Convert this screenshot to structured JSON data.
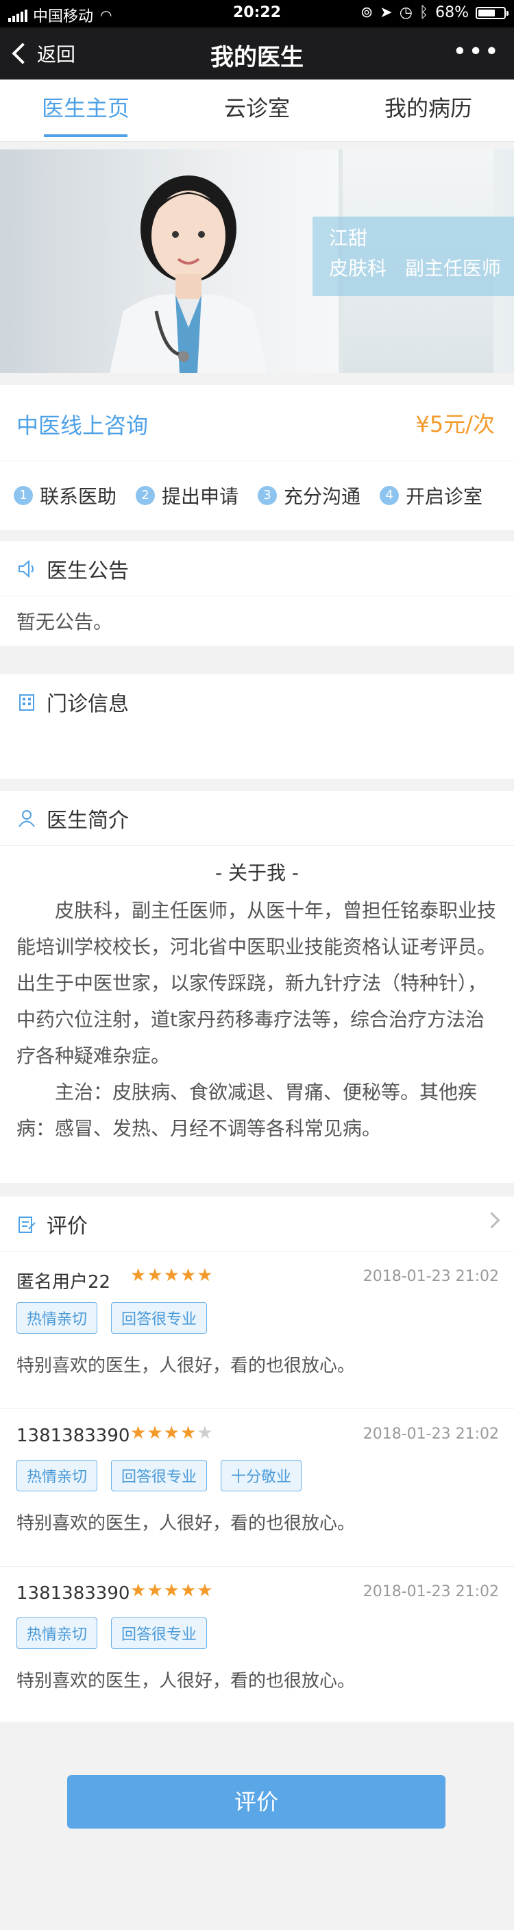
{
  "status_bar": {
    "carrier": "中国移动",
    "time": "20:22",
    "battery": "68%",
    "battery_level": 0.68
  },
  "nav": {
    "back_label": "返回",
    "title": "我的医生"
  },
  "tabs": [
    {
      "label": "医生主页",
      "active": true
    },
    {
      "label": "云诊室",
      "active": false
    },
    {
      "label": "我的病历",
      "active": false
    }
  ],
  "doctor": {
    "name": "江甜",
    "department": "皮肤科",
    "title": "副主任医师"
  },
  "consult": {
    "label": "中医线上咨询",
    "price": "¥5元/次"
  },
  "steps": [
    {
      "num": "1",
      "label": "联系医助"
    },
    {
      "num": "2",
      "label": "提出申请"
    },
    {
      "num": "3",
      "label": "充分沟通"
    },
    {
      "num": "4",
      "label": "开启诊室"
    }
  ],
  "notice": {
    "title": "医生公告",
    "body": "暂无公告。"
  },
  "clinic": {
    "title": "门诊信息"
  },
  "intro": {
    "title": "医生简介",
    "about_heading": "- 关于我 -",
    "paragraph1": "皮肤科，副主任医师，从医十年，曾担任铭泰职业技能培训学校校长，河北省中医职业技能资格认证考评员。出生于中医世家，以家传踩跷，新九针疗法（特种针），中药穴位注射，道t家丹药移毒疗法等，综合治疗方法治疗各种疑难杂症。",
    "paragraph2": "主治：皮肤病、食欲减退、胃痛、便秘等。其他疾病：感冒、发热、月经不调等各科常见病。"
  },
  "reviews": {
    "title": "评价",
    "items": [
      {
        "user": "匿名用户22",
        "stars": 5,
        "date": "2018-01-23  21:02",
        "tags": [
          "热情亲切",
          "回答很专业"
        ],
        "text": "特别喜欢的医生，人很好，看的也很放心。"
      },
      {
        "user": "1381383390",
        "stars": 4,
        "date": "2018-01-23  21:02",
        "tags": [
          "热情亲切",
          "回答很专业",
          "十分敬业"
        ],
        "text": "特别喜欢的医生，人很好，看的也很放心。"
      },
      {
        "user": "1381383390",
        "stars": 5,
        "date": "2018-01-23  21:02",
        "tags": [
          "热情亲切",
          "回答很专业"
        ],
        "text": "特别喜欢的医生，人很好，看的也很放心。"
      }
    ]
  },
  "action": {
    "evaluate_label": "评价"
  },
  "colors": {
    "accent": "#4ea1e6",
    "price": "#f39a2b",
    "star": "#f39a2b"
  }
}
